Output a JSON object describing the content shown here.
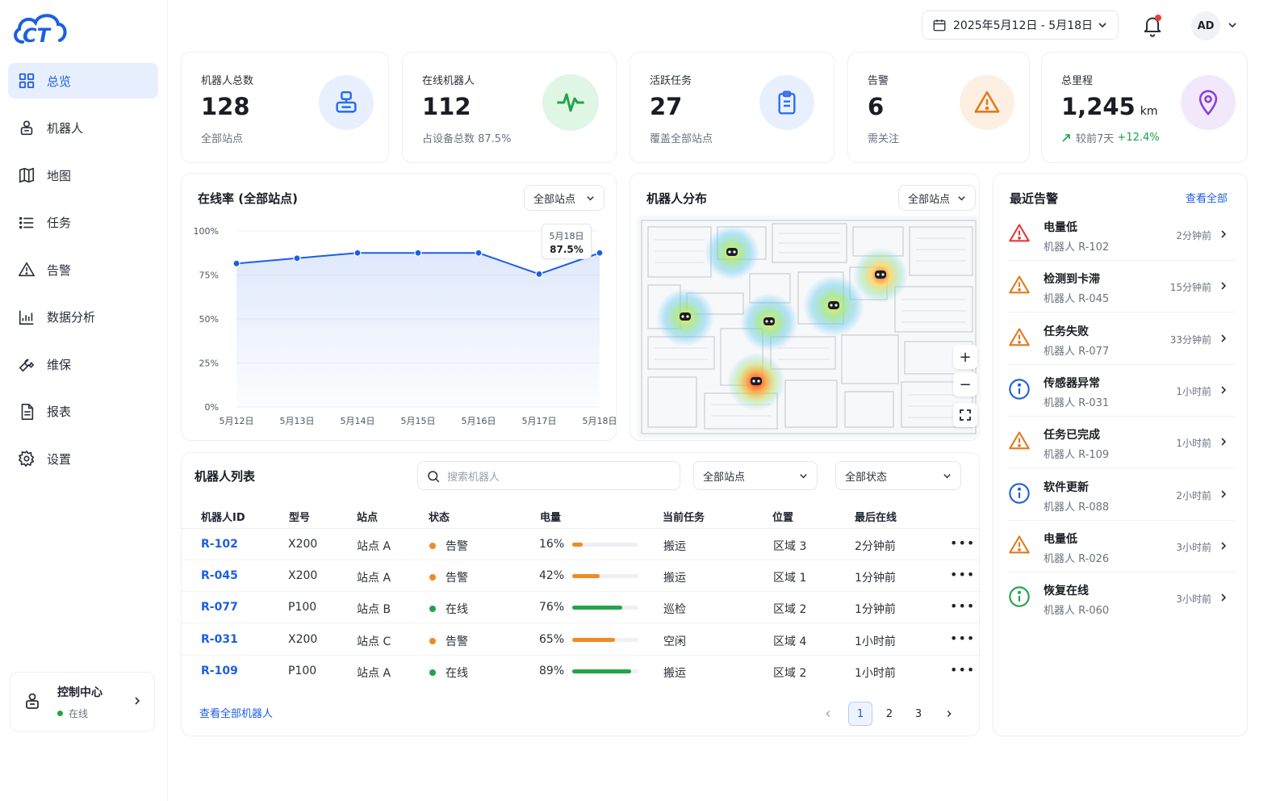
{
  "brand": {
    "logo_text": "CT",
    "color": "#1d5fe0"
  },
  "sidebar": {
    "items": [
      {
        "label": "总览",
        "icon": "grid-icon",
        "active": true
      },
      {
        "label": "机器人",
        "icon": "robot-icon"
      },
      {
        "label": "地图",
        "icon": "map-icon"
      },
      {
        "label": "任务",
        "icon": "list-icon"
      },
      {
        "label": "告警",
        "icon": "warning-icon"
      },
      {
        "label": "数据分析",
        "icon": "analytics-icon"
      },
      {
        "label": "维保",
        "icon": "wrench-icon"
      },
      {
        "label": "报表",
        "icon": "report-icon"
      },
      {
        "label": "设置",
        "icon": "gear-icon"
      }
    ],
    "control_center": {
      "title": "控制中心",
      "status": "在线"
    }
  },
  "topbar": {
    "date_range": "2025年5月12日 - 5月18日",
    "user_initials": "AD"
  },
  "stats": [
    {
      "label": "机器人总数",
      "value": "128",
      "sub": "全部站点",
      "icon": "robot-icon",
      "color": "#2f6fe6",
      "bg": "#e8f0ff"
    },
    {
      "label": "在线机器人",
      "value": "112",
      "sub": "占设备总数 87.5%",
      "icon": "activity-icon",
      "color": "#22a447",
      "bg": "#dff6e5"
    },
    {
      "label": "活跃任务",
      "value": "27",
      "sub": "覆盖全部站点",
      "icon": "clipboard-icon",
      "color": "#2f6fe6",
      "bg": "#e8f0ff"
    },
    {
      "label": "告警",
      "value": "6",
      "sub": "需关注",
      "icon": "warning-icon",
      "color": "#e07a1c",
      "bg": "#fdf0e2"
    },
    {
      "label": "总里程",
      "value": "1,245",
      "unit": "km",
      "sub_prefix": "较前7天",
      "sub_change": "+12.4%",
      "icon": "location-pin-icon",
      "color": "#8b3fd9",
      "bg": "#f1e8fb"
    }
  ],
  "online_chart": {
    "title": "在线率 (全部站点)",
    "filter": "全部站点",
    "tooltip": {
      "date": "5月18日",
      "value": "87.5%"
    }
  },
  "chart_data": {
    "type": "area",
    "categories": [
      "5月12日",
      "5月13日",
      "5月14日",
      "5月15日",
      "5月16日",
      "5月17日",
      "5月18日"
    ],
    "x_positions": [
      0,
      1,
      2,
      3,
      4,
      5,
      6
    ],
    "values": [
      81.5,
      84.5,
      87.5,
      87.5,
      87.5,
      75.5,
      87.5
    ],
    "yticks": [
      "0%",
      "25%",
      "50%",
      "75%",
      "100%"
    ],
    "ylim": [
      0,
      100
    ],
    "grid": true,
    "color": "#1d5fe0"
  },
  "robot_map": {
    "title": "机器人分布",
    "filter": "全部站点",
    "controls": {
      "zoom_in": "+",
      "zoom_out": "−"
    }
  },
  "alerts": {
    "title": "最近告警",
    "view_all": "查看全部",
    "items": [
      {
        "title": "电量低",
        "robot": "机器人 R-102",
        "time": "2分钟前",
        "level": "critical",
        "icon": "warning-icon",
        "color": "#e53935"
      },
      {
        "title": "检测到卡滞",
        "robot": "机器人 R-045",
        "time": "15分钟前",
        "level": "warning",
        "icon": "warning-icon",
        "color": "#e07a1c"
      },
      {
        "title": "任务失败",
        "robot": "机器人 R-077",
        "time": "33分钟前",
        "level": "warning",
        "icon": "warning-icon",
        "color": "#e07a1c"
      },
      {
        "title": "传感器异常",
        "robot": "机器人 R-031",
        "time": "1小时前",
        "level": "info",
        "icon": "info-icon",
        "color": "#1d5fe0"
      },
      {
        "title": "任务已完成",
        "robot": "机器人 R-109",
        "time": "1小时前",
        "level": "warning",
        "icon": "warning-icon",
        "color": "#e07a1c"
      },
      {
        "title": "软件更新",
        "robot": "机器人 R-088",
        "time": "2小时前",
        "level": "info",
        "icon": "info-icon",
        "color": "#1d5fe0"
      },
      {
        "title": "电量低",
        "robot": "机器人 R-026",
        "time": "3小时前",
        "level": "warning",
        "icon": "warning-icon",
        "color": "#e07a1c"
      },
      {
        "title": "恢复在线",
        "robot": "机器人 R-060",
        "time": "3小时前",
        "level": "success",
        "icon": "info-icon",
        "color": "#22a447"
      }
    ]
  },
  "robot_list": {
    "title": "机器人列表",
    "search_placeholder": "搜索机器人",
    "site_filter": "全部站点",
    "status_filter": "全部状态",
    "columns": [
      "机器人ID",
      "型号",
      "站点",
      "状态",
      "电量",
      "当前任务",
      "位置",
      "最后在线"
    ],
    "rows": [
      {
        "id": "R-102",
        "model": "X200",
        "site": "站点 A",
        "status": "告警",
        "status_color": "#f08a24",
        "battery": "16%",
        "battery_pct": 16,
        "battery_color": "#f08a24",
        "task": "搬运",
        "location": "区域 3",
        "last_seen": "2分钟前"
      },
      {
        "id": "R-045",
        "model": "X200",
        "site": "站点 A",
        "status": "告警",
        "status_color": "#f08a24",
        "battery": "42%",
        "battery_pct": 42,
        "battery_color": "#f08a24",
        "task": "搬运",
        "location": "区域 1",
        "last_seen": "1分钟前"
      },
      {
        "id": "R-077",
        "model": "P100",
        "site": "站点 B",
        "status": "在线",
        "status_color": "#22a447",
        "battery": "76%",
        "battery_pct": 76,
        "battery_color": "#22a447",
        "task": "巡检",
        "location": "区域 2",
        "last_seen": "1分钟前"
      },
      {
        "id": "R-031",
        "model": "X200",
        "site": "站点 C",
        "status": "告警",
        "status_color": "#f08a24",
        "battery": "65%",
        "battery_pct": 65,
        "battery_color": "#f08a24",
        "task": "空闲",
        "location": "区域 4",
        "last_seen": "1小时前"
      },
      {
        "id": "R-109",
        "model": "P100",
        "site": "站点 A",
        "status": "在线",
        "status_color": "#22a447",
        "battery": "89%",
        "battery_pct": 89,
        "battery_color": "#22a447",
        "task": "搬运",
        "location": "区域 2",
        "last_seen": "1小时前"
      }
    ],
    "view_all": "查看全部机器人",
    "pages": [
      "1",
      "2",
      "3"
    ],
    "current_page": "1"
  }
}
